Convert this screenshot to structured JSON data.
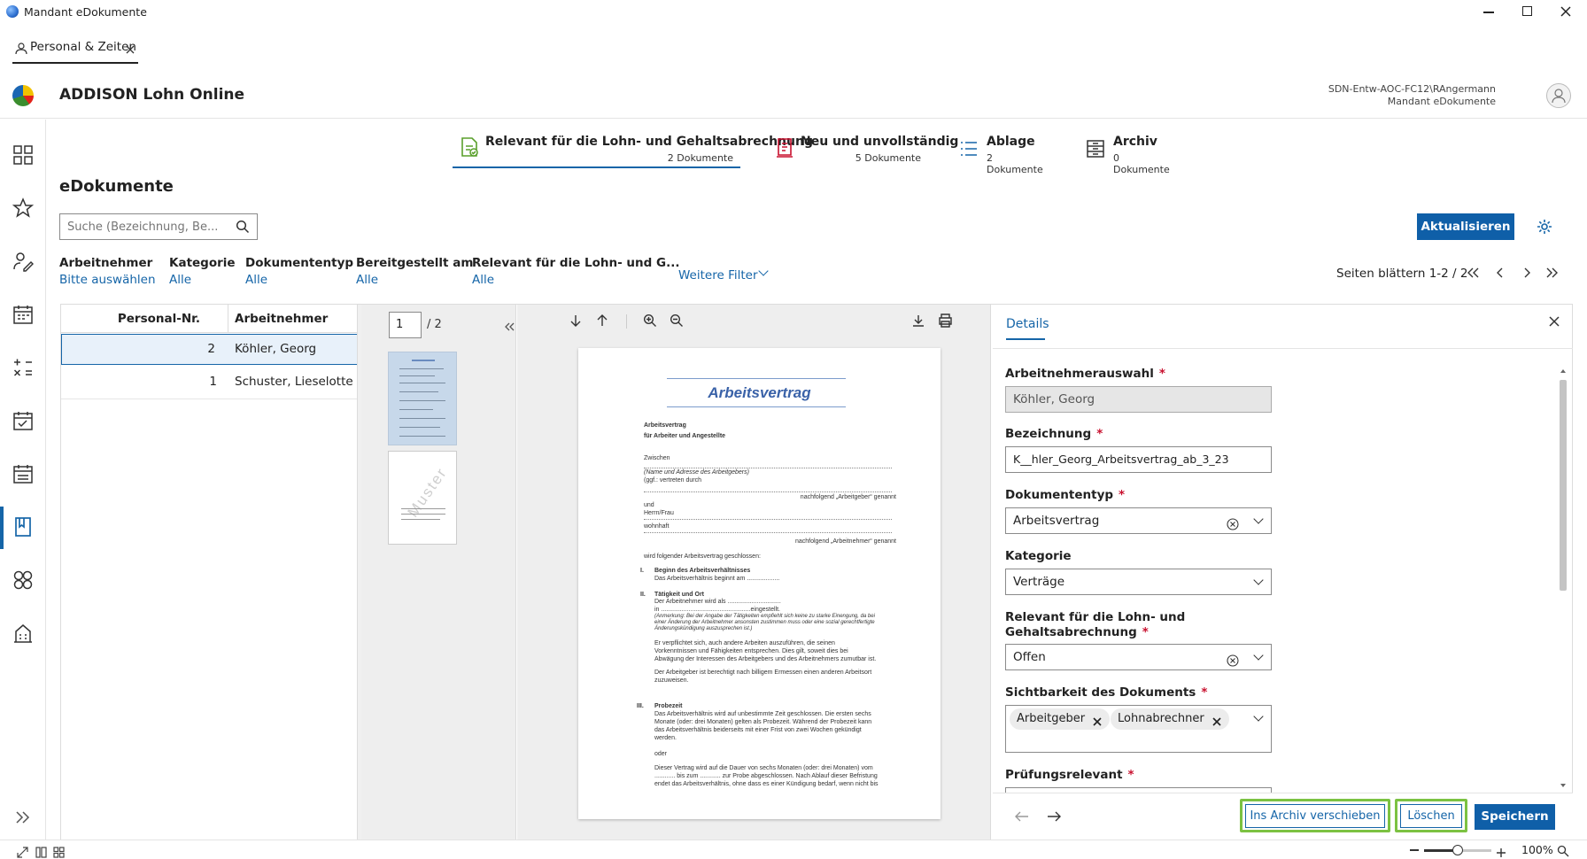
{
  "window": {
    "title": "Mandant eDokumente"
  },
  "app_tab": {
    "label": "Personal & Zeiten"
  },
  "header": {
    "app_name": "ADDISON Lohn Online",
    "user": "SDN-Entw-AOC-FC12\\RAngermann",
    "mandant": "Mandant eDokumente"
  },
  "tabs": [
    {
      "title": "Relevant für die Lohn- und Gehaltsabrechnung",
      "count": "2 Dokumente"
    },
    {
      "title": "Neu und unvollständig",
      "count": "5 Dokumente"
    },
    {
      "title": "Ablage",
      "count": "2 Dokumente"
    },
    {
      "title": "Archiv",
      "count": "0 Dokumente"
    }
  ],
  "page_title": "eDokumente",
  "search": {
    "placeholder": "Suche (Bezeichnung, Be..."
  },
  "toolbar": {
    "refresh_label": "Aktualisieren"
  },
  "filters": [
    {
      "label": "Arbeitnehmer",
      "value": "Bitte auswählen"
    },
    {
      "label": "Kategorie",
      "value": "Alle"
    },
    {
      "label": "Dokumententyp",
      "value": "Alle"
    },
    {
      "label": "Bereitgestellt am",
      "value": "Alle"
    },
    {
      "label": "Relevant für die Lohn- und G...",
      "value": "Alle"
    }
  ],
  "more_filters": "Weitere Filter",
  "pagination": {
    "label": "Seiten blättern 1-2 / 2"
  },
  "table": {
    "columns": [
      "Personal-Nr.",
      "Arbeitnehmer"
    ],
    "rows": [
      {
        "nr": "2",
        "name": "Köhler, Georg"
      },
      {
        "nr": "1",
        "name": "Schuster, Lieselotte"
      }
    ]
  },
  "viewer": {
    "page_input": "1",
    "page_total": "/ 2",
    "thumb2_watermark": "Muster"
  },
  "document": {
    "title": "Arbeitsvertrag",
    "h1": "Arbeitsvertrag",
    "h2": "für Arbeiter und Angestellte",
    "zwischen": "Zwischen",
    "name_addr": "(Name und Adresse des Arbeitgebers)",
    "vertreten": "(ggf.: vertreten durch",
    "nachfolgend_ag": "nachfolgend „Arbeitgeber“ genannt",
    "und": "und",
    "herrfrau": "Herrn/Frau",
    "wohnhaft": "wohnhaft",
    "nachfolgend_an": "nachfolgend „Arbeitnehmer“ genannt",
    "geschlossen": "wird folgender Arbeitsvertrag geschlossen:",
    "s1_num": "I.",
    "s1_title": "Beginn des Arbeitsverhältnisses",
    "s1_text": "Das Arbeitsverhältnis beginnt am ...................",
    "s2_num": "II.",
    "s2_title": "Tätigkeit und Ort",
    "s2_l1": "Der Arbeitnehmer wird als ...............................",
    "s2_l2": "in ....................................................eingestellt.",
    "s2_l3": "(Anmerkung: Bei der Angabe der Tätigkeiten empfiehlt sich keine zu starke Einengung, da bei",
    "s2_l4": "einer Änderung der Arbeitnehmer ansonsten zustimmen muss oder eine sozial gerechtfertigte",
    "s2_l5": "Änderungskündigung auszusprechen ist.)",
    "s2_p1": "Er verpflichtet sich, auch andere Arbeiten auszuführen, die seinen",
    "s2_p2": "Vorkenntnissen und Fähigkeiten entsprechen. Dies gilt, soweit dies bei",
    "s2_p3": "Abwägung der Interessen des Arbeitgebers und des Arbeitnehmers zumutbar ist.",
    "s2_p4": "Der Arbeitgeber ist berechtigt nach billigem Ermessen einen anderen Arbeitsort",
    "s2_p5": "zuzuweisen.",
    "s3_num": "III.",
    "s3_title": "Probezeit",
    "s3_l1": "Das Arbeitsverhältnis wird auf unbestimmte Zeit geschlossen. Die ersten sechs",
    "s3_l2": "Monate (oder: drei Monaten) gelten als Probezeit. Während der Probezeit kann",
    "s3_l3": "das Arbeitsverhältnis beiderseits mit einer Frist von zwei Wochen gekündigt",
    "s3_l4": "werden.",
    "s3_oder": "oder",
    "s3_m1": "Dieser Vertrag wird auf die Dauer von sechs Monaten (oder: drei Monaten) vom",
    "s3_m2": "............ bis zum ............ zur Probe abgeschlossen. Nach Ablauf dieser Befristung",
    "s3_m3": "endet das Arbeitsverhältnis, ohne dass es einer Kündigung bedarf, wenn nicht bis"
  },
  "details": {
    "tab": "Details",
    "fields": {
      "arbeitnehmer_label": "Arbeitnehmerauswahl",
      "arbeitnehmer_value": "Köhler, Georg",
      "bezeichnung_label": "Bezeichnung",
      "bezeichnung_value": "K__hler_Georg_Arbeitsvertrag_ab_3_23",
      "dokumententyp_label": "Dokumententyp",
      "dokumententyp_value": "Arbeitsvertrag",
      "kategorie_label": "Kategorie",
      "kategorie_value": "Verträge",
      "relevant_label_1": "Relevant für die Lohn- und",
      "relevant_label_2": "Gehaltsabrechnung",
      "relevant_value": "Offen",
      "sichtbarkeit_label": "Sichtbarkeit des Dokuments",
      "tags": [
        "Arbeitgeber",
        "Lohnabrechner"
      ],
      "pruefung_label": "Prüfungsrelevant"
    },
    "required_mark": "*",
    "buttons": {
      "archive": "Ins Archiv verschieben",
      "delete": "Löschen",
      "save": "Speichern"
    }
  },
  "statusbar": {
    "zoom": "100%"
  },
  "colors": {
    "accent": "#1565a8",
    "primary_button": "#0f5fa8",
    "highlight": "#7cc242",
    "selected_row": "#e8f1fa"
  }
}
